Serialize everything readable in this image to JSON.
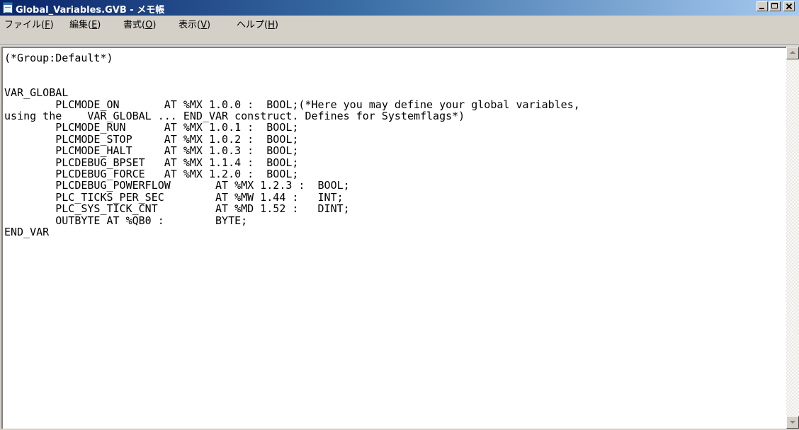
{
  "window": {
    "title": "Global_Variables.GVB - メモ帳",
    "icon": "notepad-icon"
  },
  "menu": [
    {
      "label": "ファイル(",
      "key": "F",
      "end": ")"
    },
    {
      "label": "編集(",
      "key": "E",
      "end": ")"
    },
    {
      "label": "書式(",
      "key": "O",
      "end": ")"
    },
    {
      "label": "表示(",
      "key": "V",
      "end": ")"
    },
    {
      "label": "ヘルプ(",
      "key": "H",
      "end": ")"
    }
  ],
  "document": {
    "lines": [
      "(*Group:Default*)",
      "",
      "",
      "VAR_GLOBAL",
      "        PLCMODE_ON       AT %MX 1.0.0 :  BOOL;(*Here you may define your global variables,",
      "using the    VAR_GLOBAL ... END_VAR construct. Defines for Systemflags*)",
      "        PLCMODE_RUN      AT %MX 1.0.1 :  BOOL;",
      "        PLCMODE_STOP     AT %MX 1.0.2 :  BOOL;",
      "        PLCMODE_HALT     AT %MX 1.0.3 :  BOOL;",
      "        PLCDEBUG_BPSET   AT %MX 1.1.4 :  BOOL;",
      "        PLCDEBUG_FORCE   AT %MX 1.2.0 :  BOOL;",
      "        PLCDEBUG_POWERFLOW       AT %MX 1.2.3 :  BOOL;",
      "        PLC_TICKS_PER_SEC        AT %MW 1.44 :   INT;",
      "        PLC_SYS_TICK_CNT         AT %MD 1.52 :   DINT;",
      "        OUTBYTE AT %QB0 :        BYTE;",
      "END_VAR"
    ]
  }
}
